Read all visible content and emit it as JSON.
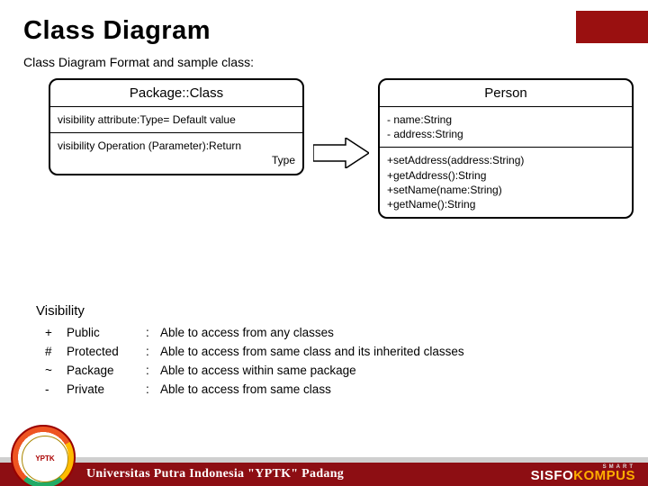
{
  "title": "Class Diagram",
  "subtitle": "Class Diagram Format and sample class:",
  "uml": {
    "format": {
      "name": "Package::Class",
      "attr": "visibility attribute:Type= Default value",
      "op_l1": "visibility Operation (Parameter):Return",
      "op_l2": "Type"
    },
    "example": {
      "name": "Person",
      "attrs": [
        "- name:String",
        "- address:String"
      ],
      "ops": [
        "+setAddress(address:String)",
        "+getAddress():String",
        "+setName(name:String)",
        "+getName():String"
      ]
    }
  },
  "visibility": {
    "heading": "Visibility",
    "rows": [
      {
        "sym": "+",
        "name": "Public",
        "desc": "Able to access from any classes"
      },
      {
        "sym": "#",
        "name": "Protected",
        "desc": "Able to access from same class and its inherited classes"
      },
      {
        "sym": "~",
        "name": "Package",
        "desc": "Able to access within same package"
      },
      {
        "sym": "-",
        "name": "Private",
        "desc": "Able to access from same class"
      }
    ]
  },
  "footer": {
    "university": "Universitas Putra Indonesia \"YPTK\" Padang",
    "logo_initials": "YPTK",
    "brand_pre": "SISFO",
    "brand_post": "KOMPUS",
    "brand_small": "SMART"
  }
}
